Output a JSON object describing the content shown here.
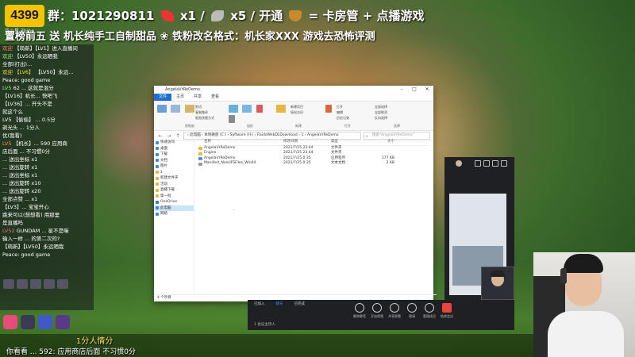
{
  "banner": {
    "logo_text": "4399",
    "logo_sub": "花火星 Zhibo",
    "line1": {
      "group": "群：1021290811",
      "rocket_count": "x1",
      "slash": "/",
      "plane_count": "x5",
      "suffix": "/ 开通",
      "rest": "= 卡房管 + 点播游戏"
    },
    "line2": "置榜前五 送 机长纯手工自制甜品 ❀  铁粉改名格式：机长家XXX  游戏去恐怖评测"
  },
  "chat": {
    "messages": [
      {
        "user": "欢迎",
        "text": "【萌新】【LV1】进入直播间",
        "color": "u"
      },
      {
        "user": "欢迎",
        "text": "【LV50】永远晒我",
        "color": "g"
      },
      {
        "user": "",
        "text": "全部(打出)...",
        "color": ""
      },
      {
        "user": "欢迎 【LV6】",
        "text": "【LV50】永远...",
        "color": "y"
      },
      {
        "user": "",
        "text": "Peace: good game",
        "color": ""
      },
      {
        "user": "LV5",
        "text": "62 ... 这就是混分",
        "color": "g"
      },
      {
        "user": "",
        "text": "【LV16】机长... 快吧飞",
        "color": "r"
      },
      {
        "user": "",
        "text": "【LV36】... 开头不是",
        "color": "u"
      },
      {
        "user": "",
        "text": "就这个么",
        "color": ""
      },
      {
        "user": "LV5",
        "text": "【偷偷】 ... 0.5分",
        "color": ""
      },
      {
        "user": "",
        "text": "剃光头 ... 1分人",
        "color": "r"
      },
      {
        "user": "",
        "text": "优(我看)",
        "color": ""
      },
      {
        "user": "LV5",
        "text": "【机长】... 590 应用商",
        "color": "u"
      },
      {
        "user": "",
        "text": "店后面 ... 不习惯0分",
        "color": ""
      },
      {
        "user": "",
        "text": "... 送出坐标 x1",
        "color": "y"
      },
      {
        "user": "",
        "text": "... 送出旋转 x1",
        "color": "g"
      },
      {
        "user": "",
        "text": "... 送出坐标 x1",
        "color": "y"
      },
      {
        "user": "",
        "text": "... 送出旋转 x10",
        "color": "g"
      },
      {
        "user": "",
        "text": "... 送出旋转 x20",
        "color": "g"
      },
      {
        "user": "",
        "text": "全部点赞 ... x1",
        "color": "u"
      },
      {
        "user": "",
        "text": "",
        "color": ""
      },
      {
        "user": "",
        "text": "【LV3】... 宝宝开心",
        "color": "r"
      },
      {
        "user": "",
        "text": "跳来可以(想想看) 用那里",
        "color": ""
      },
      {
        "user": "",
        "text": "是直播吗",
        "color": ""
      },
      {
        "user": "LV52",
        "text": "GUNDAM ... 星不是嘛",
        "color": "r"
      },
      {
        "user": "",
        "text": "输入一样 ... 的第二次的?",
        "color": ""
      },
      {
        "user": "",
        "text": "【萌新】【LV50】永远晒我",
        "color": "y"
      },
      {
        "user": "",
        "text": "Peace: good game",
        "color": ""
      }
    ]
  },
  "ticker": {
    "line1": "1分人情分",
    "line2": "你看看 ... 592: 应用商店后面 不习惯0分"
  },
  "explorer": {
    "title": "AngelaVrReDemo",
    "tabs": [
      "文件",
      "主页",
      "共享",
      "查看"
    ],
    "active_tab": "主页",
    "ribbon": {
      "clipboard": {
        "label": "剪贴板",
        "pin": "固定到快速访问",
        "copy": "复制",
        "paste": "粘贴",
        "cut": "剪切",
        "copy_path": "复制路径",
        "paste_shortcut": "粘贴快捷方式"
      },
      "organize": {
        "label": "组织",
        "move": "移动到",
        "copy": "复制到",
        "delete": "删除",
        "rename": "重命名"
      },
      "new": {
        "label": "新建",
        "new_folder": "新建文件夹",
        "new_item": "新建项目",
        "easy_access": "轻松访问"
      },
      "open": {
        "label": "打开",
        "properties": "属性",
        "open": "打开",
        "edit": "编辑",
        "history": "历史记录"
      },
      "select": {
        "label": "选择",
        "all": "全部选择",
        "none": "全部取消",
        "invert": "反向选择"
      }
    },
    "address": "› 此电脑 › 本地磁盘 (C:) › Software (H:) › RaidoWebDLDownload › 1 › AngelaVrReDemo",
    "search_placeholder": "搜索\"AngelaVrReDemo\"",
    "nav": [
      {
        "label": "快速访问",
        "color": "#3b8cdc"
      },
      {
        "label": "桌面",
        "color": "#3b8cdc"
      },
      {
        "label": "下载",
        "color": "#3b8cdc"
      },
      {
        "label": "文档",
        "color": "#3b8cdc"
      },
      {
        "label": "图片",
        "color": "#3b8cdc"
      },
      {
        "label": "1",
        "color": "#e6b741"
      },
      {
        "label": "新建文件夹",
        "color": "#e6b741"
      },
      {
        "label": "活动",
        "color": "#e6b741"
      },
      {
        "label": "直播下载",
        "color": "#e6b741"
      },
      {
        "label": "第一批",
        "color": "#e6b741"
      },
      {
        "label": "OneDrive",
        "color": "#2b7cd3"
      },
      {
        "label": "此电脑",
        "color": "#3b8cdc"
      },
      {
        "label": "网络",
        "color": "#3b8cdc"
      }
    ],
    "selected_nav": "此电脑",
    "columns": [
      "名称",
      "修改日期",
      "类型",
      "大小"
    ],
    "files": [
      {
        "name": "AngelaVrReDemo",
        "date": "2021/7/25 23:44",
        "type": "文件夹",
        "size": "",
        "kind": "folder"
      },
      {
        "name": "Engine",
        "date": "2021/7/25 23:44",
        "type": "文件夹",
        "size": "",
        "kind": "folder"
      },
      {
        "name": "AngelaVrReDemo",
        "date": "2021/7/25 0:35",
        "type": "应用程序",
        "size": "177 KB",
        "kind": "exe"
      },
      {
        "name": "Manifest_NonUFSFiles_Win64",
        "date": "2021/7/25 0:35",
        "type": "文本文档",
        "size": "2 KB",
        "kind": "txt"
      }
    ],
    "empty_hint": "...",
    "status": "4 个项目"
  },
  "meeting": {
    "tabs": [
      "已加入",
      "聊天",
      "已完成"
    ],
    "active_tab": "聊天",
    "controls": [
      {
        "label": "解除静音",
        "kind": "normal"
      },
      {
        "label": "开启视频",
        "kind": "normal"
      },
      {
        "label": "共享屏幕",
        "kind": "normal"
      },
      {
        "label": "邀请",
        "kind": "normal"
      },
      {
        "label": "管理成员",
        "kind": "normal"
      },
      {
        "label": "结束会议",
        "kind": "end"
      }
    ],
    "sub_text": "1 会议主持人"
  }
}
